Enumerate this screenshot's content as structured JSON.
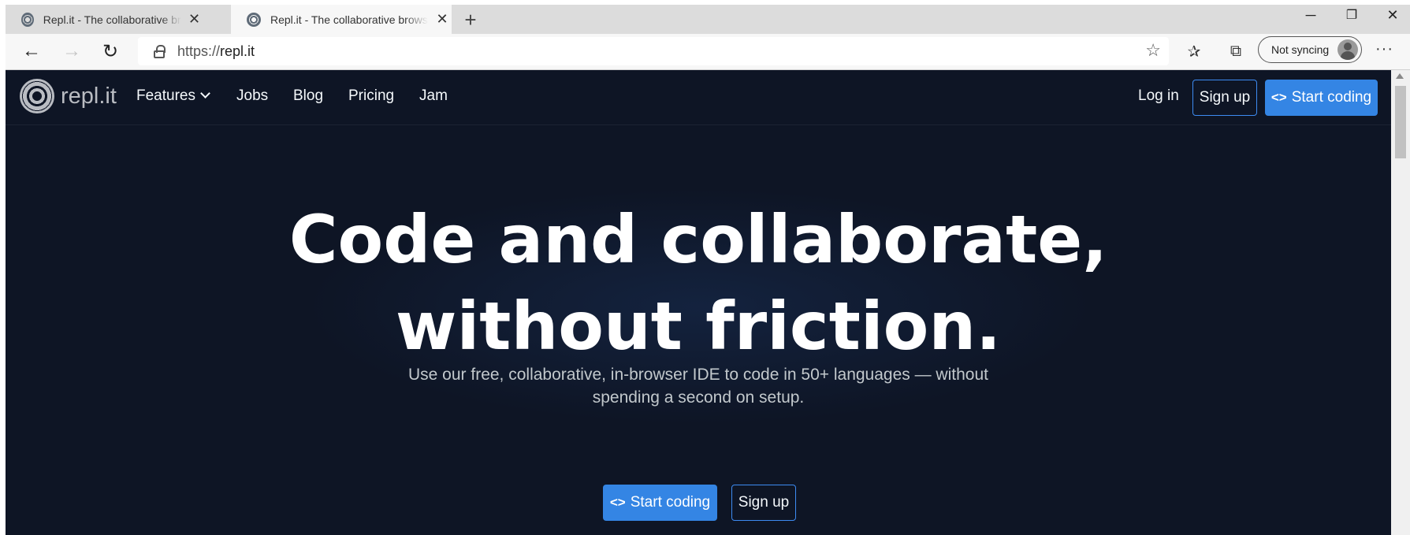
{
  "browser": {
    "tabs": [
      {
        "title": "Repl.it - The collaborative browser based IDE",
        "active": false
      },
      {
        "title": "Repl.it - The collaborative browser based IDE",
        "active": true
      }
    ],
    "window_controls": {
      "minimize": "─",
      "restore": "❐",
      "close": "✕"
    },
    "url_scheme": "https://",
    "url_host": "repl.it",
    "sync_label": "Not syncing",
    "more_label": "···"
  },
  "site": {
    "logo_text": "repl.it",
    "nav": {
      "features": "Features",
      "jobs": "Jobs",
      "blog": "Blog",
      "pricing": "Pricing",
      "jam": "Jam",
      "login": "Log in",
      "signup": "Sign up",
      "start_coding": "Start coding"
    },
    "hero": {
      "headline_line1": "Code and collaborate,",
      "headline_line2": "without friction.",
      "subtitle_line1": "Use our free, collaborative, in-browser IDE to code in 50+ languages — without",
      "subtitle_line2": "spending a second on setup.",
      "cta_primary": "Start coding",
      "cta_secondary": "Sign up"
    }
  },
  "colors": {
    "page_bg": "#0e1525",
    "primary_button": "#3485e4",
    "outline_border": "#3d8bf2"
  }
}
